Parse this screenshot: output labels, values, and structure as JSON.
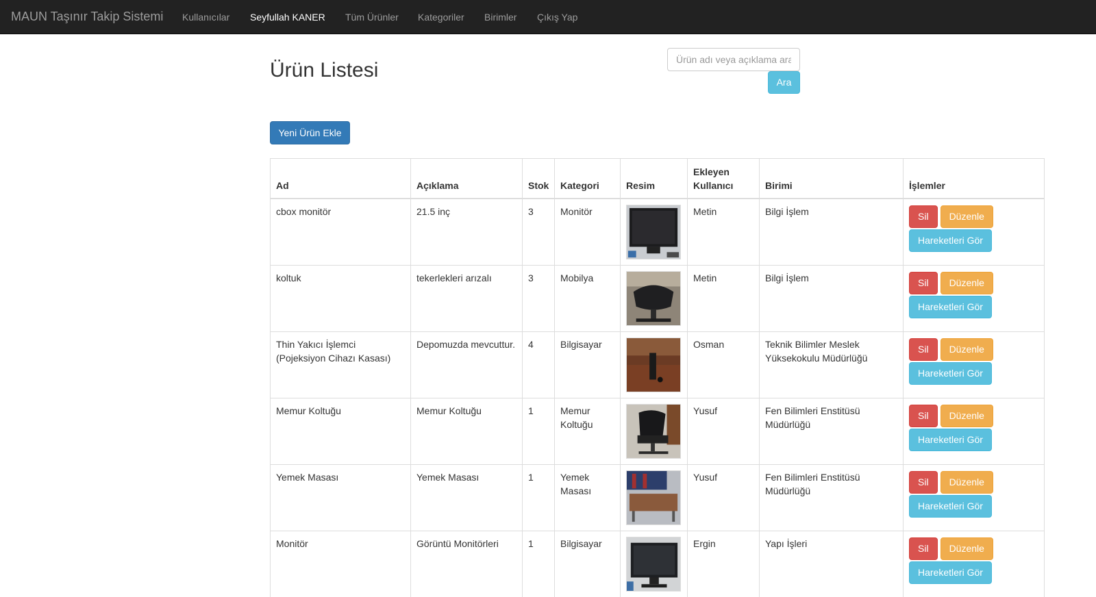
{
  "navbar": {
    "brand": "MAUN Taşınır Takip Sistemi",
    "links": [
      "Kullanıcılar",
      "Seyfullah KANER",
      "Tüm Ürünler",
      "Kategoriler",
      "Birimler",
      "Çıkış Yap"
    ]
  },
  "page": {
    "title": "Ürün Listesi",
    "search_placeholder": "Ürün adı veya açıklama ara",
    "search_button": "Ara",
    "add_button": "Yeni Ürün Ekle"
  },
  "table": {
    "headers": [
      "Ad",
      "Açıklama",
      "Stok",
      "Kategori",
      "Resim",
      "Ekleyen Kullanıcı",
      "Birimi",
      "İşlemler"
    ],
    "actions": {
      "delete": "Sil",
      "edit": "Düzenle",
      "movements": "Hareketleri Gör"
    },
    "rows": [
      {
        "name": "cbox monitör",
        "desc": "21.5 inç",
        "stock": "3",
        "category": "Monitör",
        "user": "Metin",
        "unit": "Bilgi İşlem"
      },
      {
        "name": "koltuk",
        "desc": "tekerlekleri arızalı",
        "stock": "3",
        "category": "Mobilya",
        "user": "Metin",
        "unit": "Bilgi İşlem"
      },
      {
        "name": "Thin Yakıcı İşlemci (Pojeksiyon Cihazı Kasası)",
        "desc": "Depomuzda mevcuttur.",
        "stock": "4",
        "category": "Bilgisayar",
        "user": "Osman",
        "unit": "Teknik Bilimler Meslek Yüksekokulu Müdürlüğü"
      },
      {
        "name": "Memur Koltuğu",
        "desc": "Memur Koltuğu",
        "stock": "1",
        "category": "Memur Koltuğu",
        "user": "Yusuf",
        "unit": "Fen Bilimleri Enstitüsü Müdürlüğü"
      },
      {
        "name": "Yemek Masası",
        "desc": "Yemek Masası",
        "stock": "1",
        "category": "Yemek Masası",
        "user": "Yusuf",
        "unit": "Fen Bilimleri Enstitüsü Müdürlüğü"
      },
      {
        "name": "Monitör",
        "desc": "Görüntü Monitörleri",
        "stock": "1",
        "category": "Bilgisayar",
        "user": "Ergin",
        "unit": "Yapı İşleri"
      }
    ]
  }
}
